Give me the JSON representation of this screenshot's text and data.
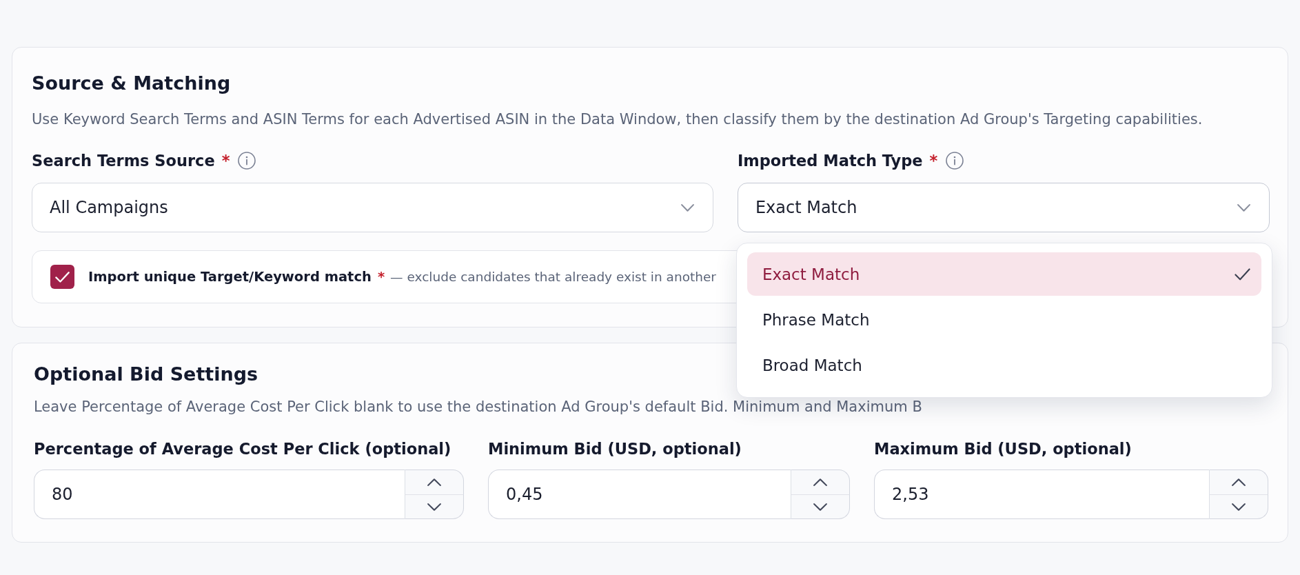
{
  "sections": [
    {
      "title": "Source & Matching",
      "description": "Use Keyword Search Terms and ASIN Terms for each Advertised ASIN in the Data Window, then classify them by the destination Ad Group's Targeting capabilities.",
      "fields": [
        {
          "kind": "select",
          "label": "Search Terms Source",
          "required_marker": "*",
          "info_icon": true,
          "value": "All Campaigns",
          "expanded": false
        },
        {
          "kind": "select",
          "label": "Imported Match Type",
          "required_marker": "*",
          "info_icon": true,
          "value": "Exact Match",
          "expanded": true,
          "options": [
            {
              "label": "Exact Match",
              "selected": true
            },
            {
              "label": "Phrase Match",
              "selected": false
            },
            {
              "label": "Broad Match",
              "selected": false
            }
          ]
        }
      ],
      "option_row": {
        "kind": "checkbox",
        "label": "Import unique Target/Keyword match",
        "required_marker": "*",
        "description": "— exclude candidates that already exist in another",
        "checked": true
      }
    },
    {
      "title": "Optional Bid Settings",
      "description": "Leave Percentage of Average Cost Per Click blank to use the destination Ad Group's default Bid. Minimum and Maximum B",
      "fields": [
        {
          "kind": "number",
          "label": "Percentage of Average Cost Per Click (optional)",
          "value": "80"
        },
        {
          "kind": "number",
          "label": "Minimum Bid (USD, optional)",
          "value": "0,45"
        },
        {
          "kind": "number",
          "label": "Maximum Bid (USD, optional)",
          "value": "2,53"
        }
      ]
    }
  ]
}
